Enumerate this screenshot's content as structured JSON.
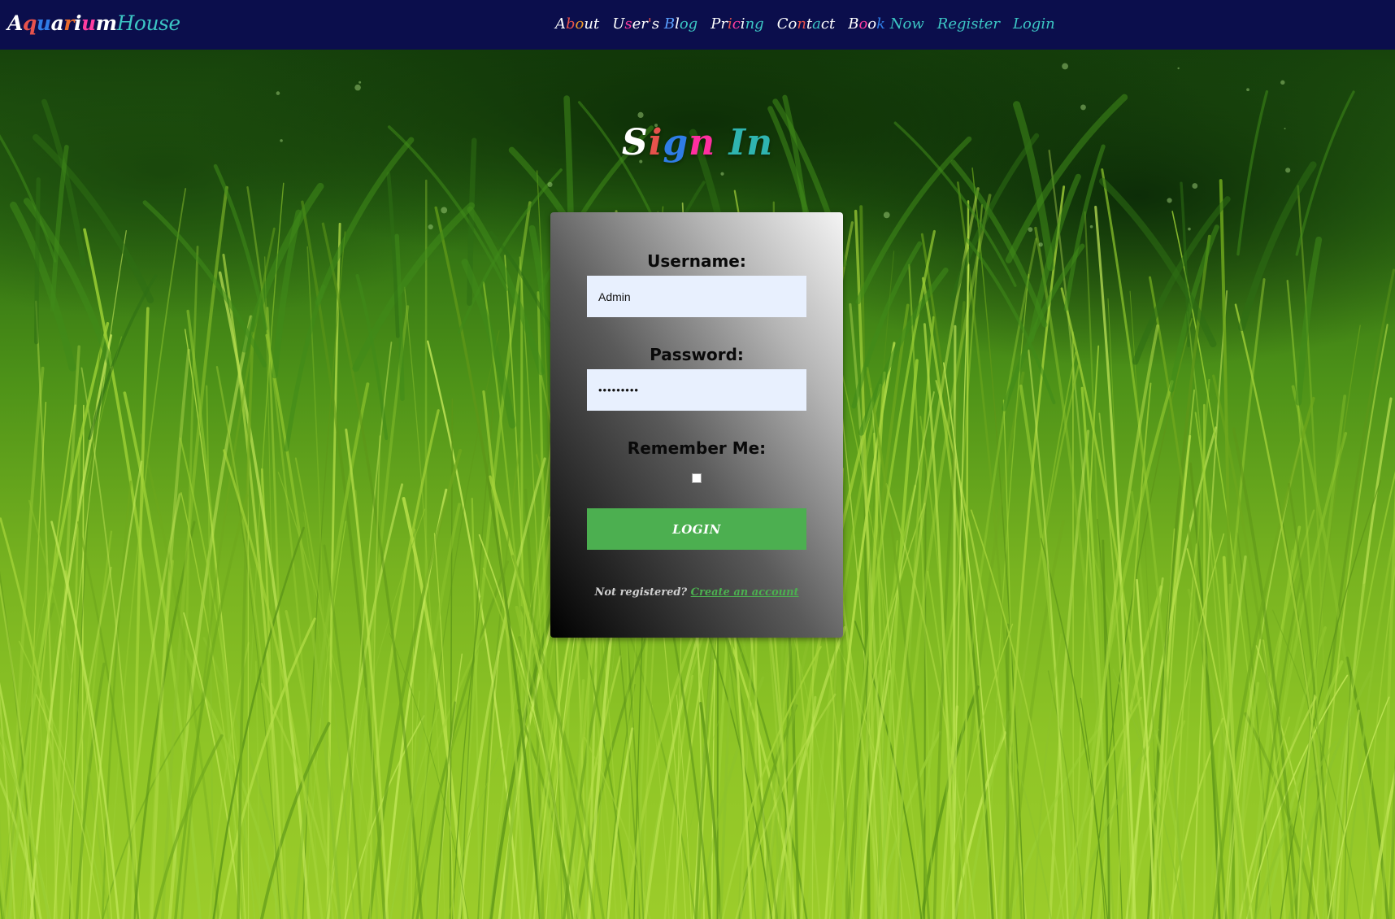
{
  "brand": {
    "letters_part1": [
      {
        "ch": "A",
        "color": "#ffffff"
      },
      {
        "ch": "q",
        "color": "#e6524c"
      },
      {
        "ch": "u",
        "color": "#2f7de6"
      },
      {
        "ch": "a",
        "color": "#ffffff"
      },
      {
        "ch": "r",
        "color": "#e86c2c"
      },
      {
        "ch": "i",
        "color": "#ffffff"
      },
      {
        "ch": "u",
        "color": "#ff3da0"
      },
      {
        "ch": "m",
        "color": "#ffffff"
      }
    ],
    "part2": "House"
  },
  "nav": {
    "items": [
      {
        "name": "nav-about",
        "letters": [
          {
            "ch": "A",
            "color": "#ffffff"
          },
          {
            "ch": "b",
            "color": "#e6524c"
          },
          {
            "ch": "o",
            "color": "#f09a2a"
          },
          {
            "ch": "u",
            "color": "#ffffff"
          },
          {
            "ch": "t",
            "color": "#ffffff"
          }
        ]
      },
      {
        "name": "nav-users-blog",
        "letters": [
          {
            "ch": "U",
            "color": "#ffffff"
          },
          {
            "ch": "s",
            "color": "#ff3da0"
          },
          {
            "ch": "e",
            "color": "#ffffff"
          },
          {
            "ch": "r",
            "color": "#ffffff"
          },
          {
            "ch": "'",
            "color": "#e6524c"
          },
          {
            "ch": "s",
            "color": "#ffffff"
          },
          {
            "ch": " ",
            "color": "#ffffff"
          },
          {
            "ch": "B",
            "color": "#5aa0ff"
          },
          {
            "ch": "l",
            "color": "#ffffff"
          },
          {
            "ch": "o",
            "color": "#3cc6c4"
          },
          {
            "ch": "g",
            "color": "#3cc6c4"
          }
        ]
      },
      {
        "name": "nav-pricing",
        "letters": [
          {
            "ch": "P",
            "color": "#ffffff"
          },
          {
            "ch": "r",
            "color": "#ffffff"
          },
          {
            "ch": "i",
            "color": "#e6524c"
          },
          {
            "ch": "c",
            "color": "#ff3da0"
          },
          {
            "ch": "i",
            "color": "#ffffff"
          },
          {
            "ch": "n",
            "color": "#3cc6c4"
          },
          {
            "ch": "g",
            "color": "#3cc6c4"
          }
        ]
      },
      {
        "name": "nav-contact",
        "letters": [
          {
            "ch": "C",
            "color": "#ffffff"
          },
          {
            "ch": "o",
            "color": "#ffffff"
          },
          {
            "ch": "n",
            "color": "#e6524c"
          },
          {
            "ch": "t",
            "color": "#ffffff"
          },
          {
            "ch": "a",
            "color": "#3cc6c4"
          },
          {
            "ch": "c",
            "color": "#ffffff"
          },
          {
            "ch": "t",
            "color": "#ffffff"
          }
        ]
      },
      {
        "name": "nav-book-now",
        "letters": [
          {
            "ch": "B",
            "color": "#ffffff"
          },
          {
            "ch": "o",
            "color": "#ff3da0"
          },
          {
            "ch": "o",
            "color": "#ffffff"
          },
          {
            "ch": "k",
            "color": "#2f7de6"
          },
          {
            "ch": " ",
            "color": "#ffffff"
          },
          {
            "ch": "N",
            "color": "#3cc6c4"
          },
          {
            "ch": "o",
            "color": "#3cc6c4"
          },
          {
            "ch": "w",
            "color": "#3cc6c4"
          }
        ]
      }
    ],
    "register": "Register",
    "login": "Login"
  },
  "title": {
    "letters": [
      {
        "ch": "S",
        "color": "#ffffff"
      },
      {
        "ch": "i",
        "color": "#e6524c"
      },
      {
        "ch": "g",
        "color": "#2f7de6"
      },
      {
        "ch": "n",
        "color": "#ff2fa0"
      },
      {
        "ch": " ",
        "color": "#ffffff"
      },
      {
        "ch": "I",
        "color": "#2fb4b0"
      },
      {
        "ch": "n",
        "color": "#2fb4b0"
      }
    ]
  },
  "form": {
    "username_label": "Username:",
    "username_value": "Admin",
    "password_label": "Password:",
    "password_value": "•••••••••",
    "remember_label": "Remember Me:",
    "login_button": "LOGIN",
    "not_registered": "Not registered? ",
    "create_account": "Create an account"
  },
  "colors": {
    "navbar_bg": "#0b0e4c",
    "accent_teal": "#3cc6c4",
    "button_green": "#4caf50",
    "input_bg": "#e8f0fe"
  }
}
